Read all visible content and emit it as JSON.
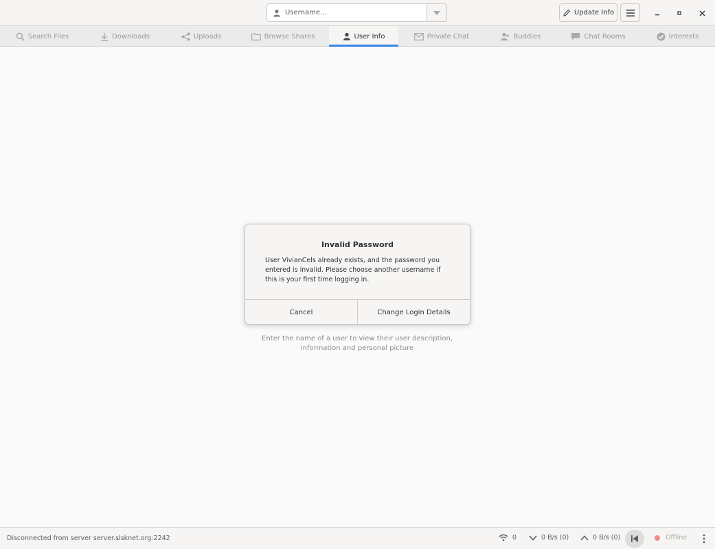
{
  "header": {
    "username_placeholder": "Username...",
    "update_info_label": "Update Info"
  },
  "tabs": [
    {
      "label": "Search Files",
      "icon": "search-icon"
    },
    {
      "label": "Downloads",
      "icon": "download-icon"
    },
    {
      "label": "Uploads",
      "icon": "share-icon"
    },
    {
      "label": "Browse Shares",
      "icon": "folder-icon"
    },
    {
      "label": "User Info",
      "icon": "user-icon",
      "active": true
    },
    {
      "label": "Private Chat",
      "icon": "mail-icon"
    },
    {
      "label": "Buddies",
      "icon": "buddies-icon"
    },
    {
      "label": "Chat Rooms",
      "icon": "chat-icon"
    },
    {
      "label": "Interests",
      "icon": "check-circle-icon"
    }
  ],
  "main": {
    "placeholder_line1": "Enter the name of a user to view their user description,",
    "placeholder_line2": "information and personal picture"
  },
  "dialog": {
    "title": "Invalid Password",
    "body": "User VivianCels already exists, and the password you entered is invalid. Please choose another username if this is your first time logging in.",
    "cancel_label": "Cancel",
    "confirm_label": "Change Login Details"
  },
  "statusbar": {
    "message": "Disconnected from server server.slsknet.org:2242",
    "connections": "0",
    "download_speed": "0 B/s (0)",
    "upload_speed": "0 B/s (0)",
    "connection_status": "Offline"
  },
  "colors": {
    "accent": "#3584e4",
    "offline_dot": "#f08a8a"
  }
}
